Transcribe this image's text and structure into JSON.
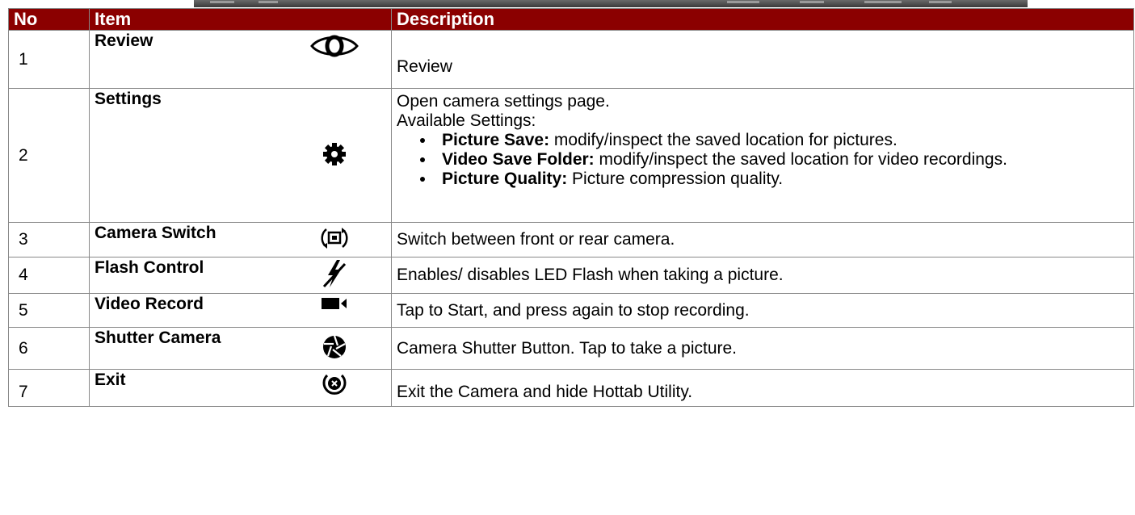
{
  "table": {
    "headers": {
      "no": "No",
      "item": "Item",
      "description": "Description"
    },
    "rows": [
      {
        "no": "1",
        "item": "Review",
        "icon": "eye-icon",
        "description": "Review"
      },
      {
        "no": "2",
        "item": "Settings",
        "icon": "gear-icon",
        "description": "Open camera settings page.",
        "subheading": "Available Settings:",
        "options": [
          {
            "name": "Picture Save:",
            "text": " modify/inspect the saved location for pictures."
          },
          {
            "name": "Video Save Folder:",
            "text": " modify/inspect the saved location for video recordings."
          },
          {
            "name": "Picture Quality:",
            "text": " Picture compression quality."
          }
        ]
      },
      {
        "no": "3",
        "item": "Camera Switch",
        "icon": "camera-switch-icon",
        "description": "Switch between front or rear camera."
      },
      {
        "no": "4",
        "item": "Flash Control",
        "icon": "flash-off-icon",
        "description": "Enables/ disables LED Flash when taking a picture."
      },
      {
        "no": "5",
        "item": "Video Record",
        "icon": "video-camera-icon",
        "description": "Tap to Start, and press again to stop recording."
      },
      {
        "no": "6",
        "item": "Shutter Camera",
        "icon": "shutter-icon",
        "description": "Camera Shutter Button. Tap to take a picture."
      },
      {
        "no": "7",
        "item": "Exit",
        "icon": "exit-icon",
        "description": "Exit the Camera and hide Hottab Utility."
      }
    ]
  },
  "colors": {
    "header_background": "#8b0000",
    "header_text": "#ffffff",
    "border": "#888888"
  }
}
